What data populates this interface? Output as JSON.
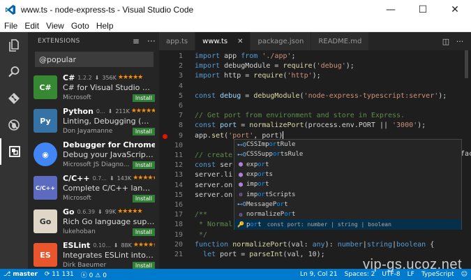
{
  "window": {
    "title": "www.ts - node-express-ts - Visual Studio Code",
    "minimize": "—",
    "maximize": "☐",
    "close": "✕"
  },
  "menu": [
    "File",
    "Edit",
    "View",
    "Goto",
    "Help"
  ],
  "activity": [
    "files-icon",
    "search-icon",
    "git-icon",
    "debug-icon",
    "extensions-icon"
  ],
  "sidebar": {
    "title": "EXTENSIONS",
    "search_value": "@popular",
    "extensions": [
      {
        "name": "C#",
        "version": "1.2.2",
        "downloads": "356K",
        "stars": "★★★★★",
        "description": "C# for Visual Studio Code (p...",
        "publisher": "Microsoft",
        "action": "Install",
        "icon": "csharp-logo",
        "color": "#368832"
      },
      {
        "name": "Python",
        "version": "0...",
        "downloads": "211K",
        "stars": "★★★★★",
        "description": "Linting, Debugging (multi-t...",
        "publisher": "Don Jayamanne",
        "action": "Install",
        "icon": "python-logo",
        "color": "#3572a5"
      },
      {
        "name": "Debugger for Chrome",
        "version": "",
        "downloads": "148",
        "stars": "",
        "description": "Debug your JavaScript code...",
        "publisher": "Microsoft JS Diagno...",
        "action": "Install",
        "icon": "chrome-logo",
        "color": "#4285f4"
      },
      {
        "name": "C/C++",
        "version": "0.7...",
        "downloads": "143K",
        "stars": "★★★★★",
        "description": "Complete C/C++ language ...",
        "publisher": "Microsoft",
        "action": "Install",
        "icon": "cpp-logo",
        "color": "#5c6bc0"
      },
      {
        "name": "Go",
        "version": "0.6.39",
        "downloads": "99K",
        "stars": "★★★★★",
        "description": "Rich Go language support f...",
        "publisher": "lukehoban",
        "action": "Install",
        "icon": "go-logo",
        "color": "#e0d6c8"
      },
      {
        "name": "ESLint",
        "version": "0.10...",
        "downloads": "88K",
        "stars": "★★★★★",
        "description": "Integrates ESLint into VS Co...",
        "publisher": "Dirk Baeumer",
        "action": "Install",
        "icon": "eslint-logo",
        "color": "#e9552c"
      }
    ]
  },
  "tabs": [
    {
      "label": "app.ts",
      "active": false
    },
    {
      "label": "www.ts",
      "active": true,
      "close": "✕"
    },
    {
      "label": "package.json",
      "active": false
    },
    {
      "label": "README.md",
      "active": false
    }
  ],
  "editor": {
    "lines": [
      {
        "n": "1",
        "parts": [
          [
            "kw",
            "import"
          ],
          [
            "pl",
            " app "
          ],
          [
            "kw",
            "from"
          ],
          [
            "pl",
            " "
          ],
          [
            "str",
            "'./app'"
          ],
          [
            "pl",
            ";"
          ]
        ]
      },
      {
        "n": "2",
        "parts": [
          [
            "kw",
            "import"
          ],
          [
            "pl",
            " debugModule = "
          ],
          [
            "fn",
            "require"
          ],
          [
            "pl",
            "("
          ],
          [
            "str",
            "'debug'"
          ],
          [
            "pl",
            ");"
          ]
        ]
      },
      {
        "n": "3",
        "parts": [
          [
            "kw",
            "import"
          ],
          [
            "pl",
            " http = "
          ],
          [
            "fn",
            "require"
          ],
          [
            "pl",
            "("
          ],
          [
            "str",
            "'http'"
          ],
          [
            "pl",
            ");"
          ]
        ]
      },
      {
        "n": "4",
        "parts": []
      },
      {
        "n": "5",
        "parts": [
          [
            "kw",
            "const"
          ],
          [
            "pl",
            " "
          ],
          [
            "id",
            "debug"
          ],
          [
            "pl",
            " = "
          ],
          [
            "fn",
            "debugModule"
          ],
          [
            "pl",
            "("
          ],
          [
            "str",
            "'node-express-typescript:server'"
          ],
          [
            "pl",
            ");"
          ]
        ]
      },
      {
        "n": "6",
        "parts": []
      },
      {
        "n": "7",
        "parts": [
          [
            "cm",
            "// Get port from environment and store in Express."
          ]
        ]
      },
      {
        "n": "8",
        "parts": [
          [
            "kw",
            "const"
          ],
          [
            "pl",
            " "
          ],
          [
            "id",
            "port"
          ],
          [
            "pl",
            " = "
          ],
          [
            "fn",
            "normalizePort"
          ],
          [
            "pl",
            "(process.env.PORT || "
          ],
          [
            "str",
            "'3000'"
          ],
          [
            "pl",
            ");"
          ]
        ]
      },
      {
        "n": "9",
        "parts": [
          [
            "pl",
            "app."
          ],
          [
            "fn",
            "set"
          ],
          [
            "pl",
            "("
          ],
          [
            "str",
            "'port'"
          ],
          [
            "pl",
            ", port)"
          ]
        ],
        "breakpoint": true
      },
      {
        "n": "10",
        "parts": []
      },
      {
        "n": "11",
        "parts": [
          [
            "cm",
            "// create"
          ]
        ]
      },
      {
        "n": "12",
        "parts": [
          [
            "kw",
            "const"
          ],
          [
            "pl",
            " ser"
          ]
        ]
      },
      {
        "n": "13",
        "parts": [
          [
            "pl",
            "server.li"
          ]
        ]
      },
      {
        "n": "14",
        "parts": [
          [
            "pl",
            "server.on"
          ]
        ]
      },
      {
        "n": "15",
        "parts": [
          [
            "pl",
            "server.on"
          ]
        ]
      },
      {
        "n": "16",
        "parts": []
      },
      {
        "n": "17",
        "parts": [
          [
            "cm",
            "/**"
          ]
        ]
      },
      {
        "n": "18",
        "parts": [
          [
            "cm",
            " * Normal"
          ]
        ]
      },
      {
        "n": "19",
        "parts": [
          [
            "cm",
            " */"
          ]
        ]
      },
      {
        "n": "20",
        "parts": [
          [
            "kw",
            "function"
          ],
          [
            "pl",
            " "
          ],
          [
            "fn",
            "normalizePort"
          ],
          [
            "pl",
            "(val: "
          ],
          [
            "kw",
            "any"
          ],
          [
            "pl",
            "): "
          ],
          [
            "kw",
            "number"
          ],
          [
            "pl",
            "|"
          ],
          [
            "kw",
            "string"
          ],
          [
            "pl",
            "|"
          ],
          [
            "kw",
            "boolean"
          ],
          [
            "pl",
            " {"
          ]
        ]
      },
      {
        "n": "21",
        "parts": [
          [
            "pl",
            "  "
          ],
          [
            "kw",
            "let"
          ],
          [
            "pl",
            " port = "
          ],
          [
            "fn",
            "parseInt"
          ],
          [
            "pl",
            "(val, 10);"
          ]
        ]
      }
    ],
    "overflow_hint": "fac"
  },
  "suggest": {
    "items": [
      {
        "icon": "⊷O",
        "pre": "CSSImp",
        "hl": "or",
        "post": "tRule",
        "color": "#75beff"
      },
      {
        "icon": "⊷O",
        "pre": "CSSSupp",
        "hl": "or",
        "post": "tsRule",
        "color": "#75beff"
      },
      {
        "icon": "⬢",
        "pre": "exp",
        "hl": "or",
        "post": "t",
        "color": "#b180d7"
      },
      {
        "icon": "⬢",
        "pre": "exp",
        "hl": "or",
        "post": "ts",
        "color": "#b180d7"
      },
      {
        "icon": "⬢",
        "pre": "imp",
        "hl": "or",
        "post": "t",
        "color": "#b180d7"
      },
      {
        "icon": "⚙",
        "pre": "imp",
        "hl": "or",
        "post": "tScripts",
        "color": "#b180d7"
      },
      {
        "icon": "⊷O",
        "pre": "MessageP",
        "hl": "or",
        "post": "t",
        "color": "#75beff"
      },
      {
        "icon": "⚙",
        "pre": "normalizeP",
        "hl": "or",
        "post": "t",
        "color": "#b180d7"
      },
      {
        "icon": "🔑",
        "pre": "p",
        "hl": "or",
        "post": "t",
        "detail": "const port: number | string | boolean",
        "color": "#75beff",
        "selected": true
      }
    ]
  },
  "status": {
    "branch": "master",
    "sync": "11 131",
    "errors": "0",
    "warnings": "0",
    "position": "Ln 9, Col 21",
    "spaces": "Spaces: 2",
    "encoding": "UTF-8",
    "eol": "LF",
    "language": "TypeScript"
  },
  "watermark": "vip-gs.ucoz.net",
  "colors": {
    "status_bar": "#007acc",
    "install_button": "#327e36",
    "star": "#ff8e00"
  }
}
